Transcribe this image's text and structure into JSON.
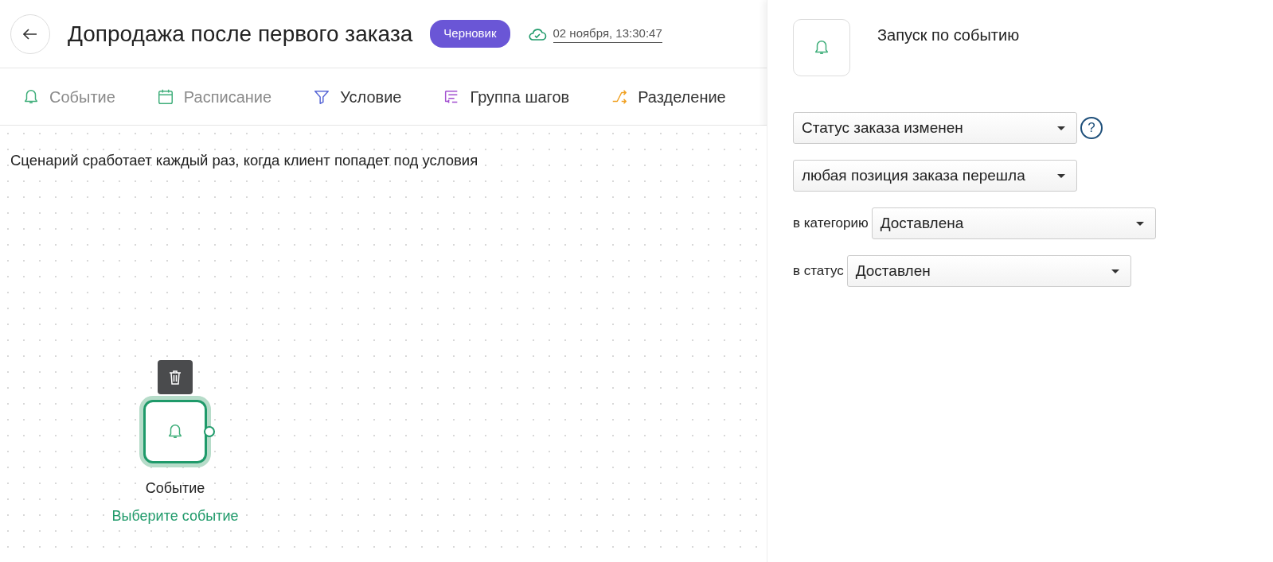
{
  "header": {
    "title": "Допродажа после первого заказа",
    "status_badge": "Черновик",
    "saved_at": "02 ноября, 13:30:47"
  },
  "toolbar": [
    {
      "label": "Событие",
      "kind": "bell",
      "color": "#3fae7a",
      "disabled": true
    },
    {
      "label": "Расписание",
      "kind": "calendar",
      "color": "#3fae7a",
      "disabled": true
    },
    {
      "label": "Условие",
      "kind": "funnel",
      "color": "#5867d6",
      "disabled": false
    },
    {
      "label": "Группа шагов",
      "kind": "group",
      "color": "#a24fd0",
      "disabled": false
    },
    {
      "label": "Разделение",
      "kind": "split",
      "color": "#f0a020",
      "disabled": false
    }
  ],
  "canvas": {
    "description": "Сценарий сработает каждый раз, когда клиент попадет под условия",
    "node": {
      "title": "Событие",
      "subtitle": "Выберите событие",
      "selected": true
    }
  },
  "panel": {
    "title": "Запуск по событию",
    "fields": [
      {
        "value": "Статус заказа изменен",
        "help_button": "?"
      },
      {
        "value": "любая позиция заказа перешла"
      },
      {
        "label": "в категорию",
        "value": "Доставлена"
      },
      {
        "label": "в статус",
        "value": "Доставлен"
      }
    ]
  }
}
